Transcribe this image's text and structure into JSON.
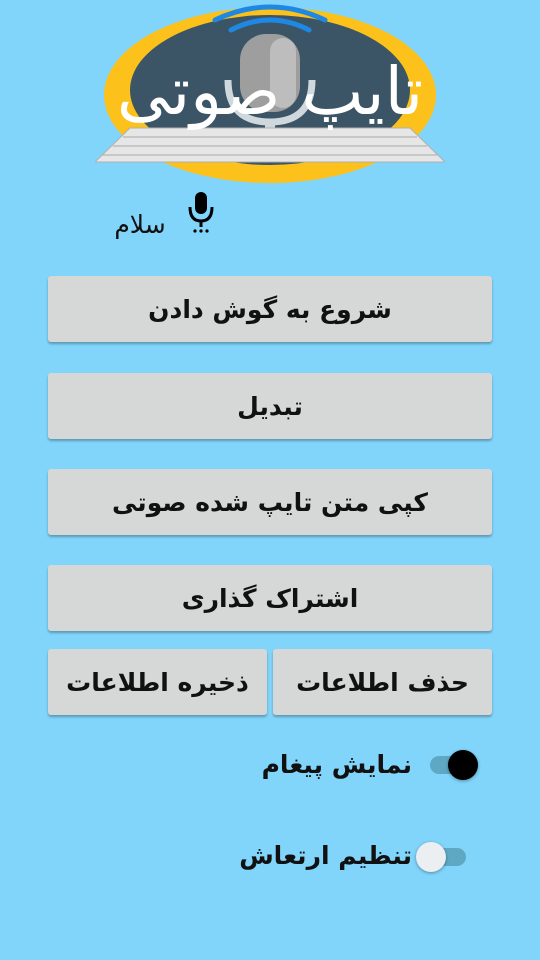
{
  "logo": {
    "title": "تایپ صوتی",
    "icons": [
      "microphone-icon",
      "wifi-signal-icon",
      "keyboard-icon"
    ],
    "colors": {
      "ring": "#fcc21b",
      "disc": "#3c5566",
      "signal": "#1e88e5"
    }
  },
  "recognized_text": "سلام",
  "mic_icon": "microphone-icon",
  "buttons": {
    "start_listening": "شروع به گوش دادن",
    "convert": "تبدیل",
    "copy_text": "کپی متن تایپ شده صوتی",
    "share": "اشتراک گذاری",
    "delete_data": "حذف اطلاعات",
    "save_data": "ذخیره اطلاعات"
  },
  "toggles": {
    "show_message": {
      "label": "نمایش پیغام",
      "checked": true
    },
    "vibration": {
      "label": "تنظیم ارتعاش",
      "checked": false
    }
  },
  "colors": {
    "background": "#81d4fa",
    "button": "#d6d7d7"
  }
}
